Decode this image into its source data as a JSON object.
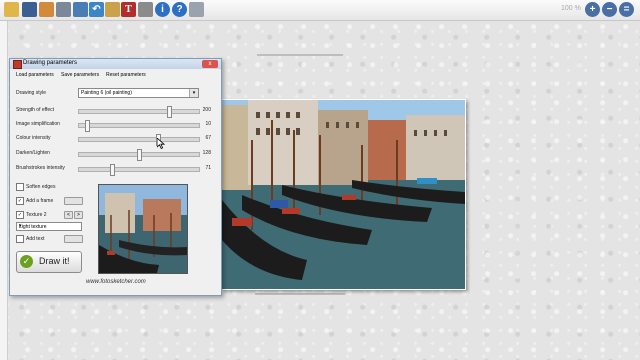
{
  "toolbar": {
    "icons": [
      "open-folder-icon",
      "save-icon",
      "copy-icon",
      "paste-icon",
      "crop-icon",
      "undo-icon",
      "palette-icon",
      "text-tool-icon",
      "print-icon",
      "info-icon",
      "help-icon",
      "screen-icon"
    ],
    "zoom_text": "100 %",
    "zoom_icons": [
      "zoom-in-icon",
      "zoom-out-icon",
      "zoom-fit-icon"
    ]
  },
  "dialog": {
    "title": "Drawing parameters",
    "close": "x",
    "tabs": [
      "Load parameters",
      "Save parameters",
      "Reset parameters"
    ],
    "style_label": "Drawing style",
    "style_value": "Painting 6 (oil painting)",
    "sliders": [
      {
        "label": "Strength of effect",
        "value": "200",
        "level": 0.76
      },
      {
        "label": "Image simplification",
        "value": "10",
        "level": 0.05
      },
      {
        "label": "Colour intensity",
        "value": "67",
        "level": 0.66
      },
      {
        "label": "Darken/Lighten",
        "value": "128",
        "level": 0.5
      },
      {
        "label": "Brushstrokes intensity",
        "value": "71",
        "level": 0.27
      }
    ],
    "checkboxes": [
      {
        "label": "Soften edges",
        "checked": false,
        "mark": ""
      },
      {
        "label": "Add a frame",
        "checked": true,
        "mark": "✓"
      },
      {
        "label": "Texture 2",
        "checked": true,
        "mark": "✓"
      },
      {
        "label": "Add text",
        "checked": false,
        "mark": ""
      }
    ],
    "texture_select": "Light texture",
    "texture_arrows": [
      "<",
      ">"
    ],
    "draw_button": "Draw it!",
    "footer": "www.fotosketcher.com"
  },
  "colors": {
    "accent": "#6aa121",
    "titlebar": "#c3d3ea",
    "canvas": "#e4e4e4"
  }
}
